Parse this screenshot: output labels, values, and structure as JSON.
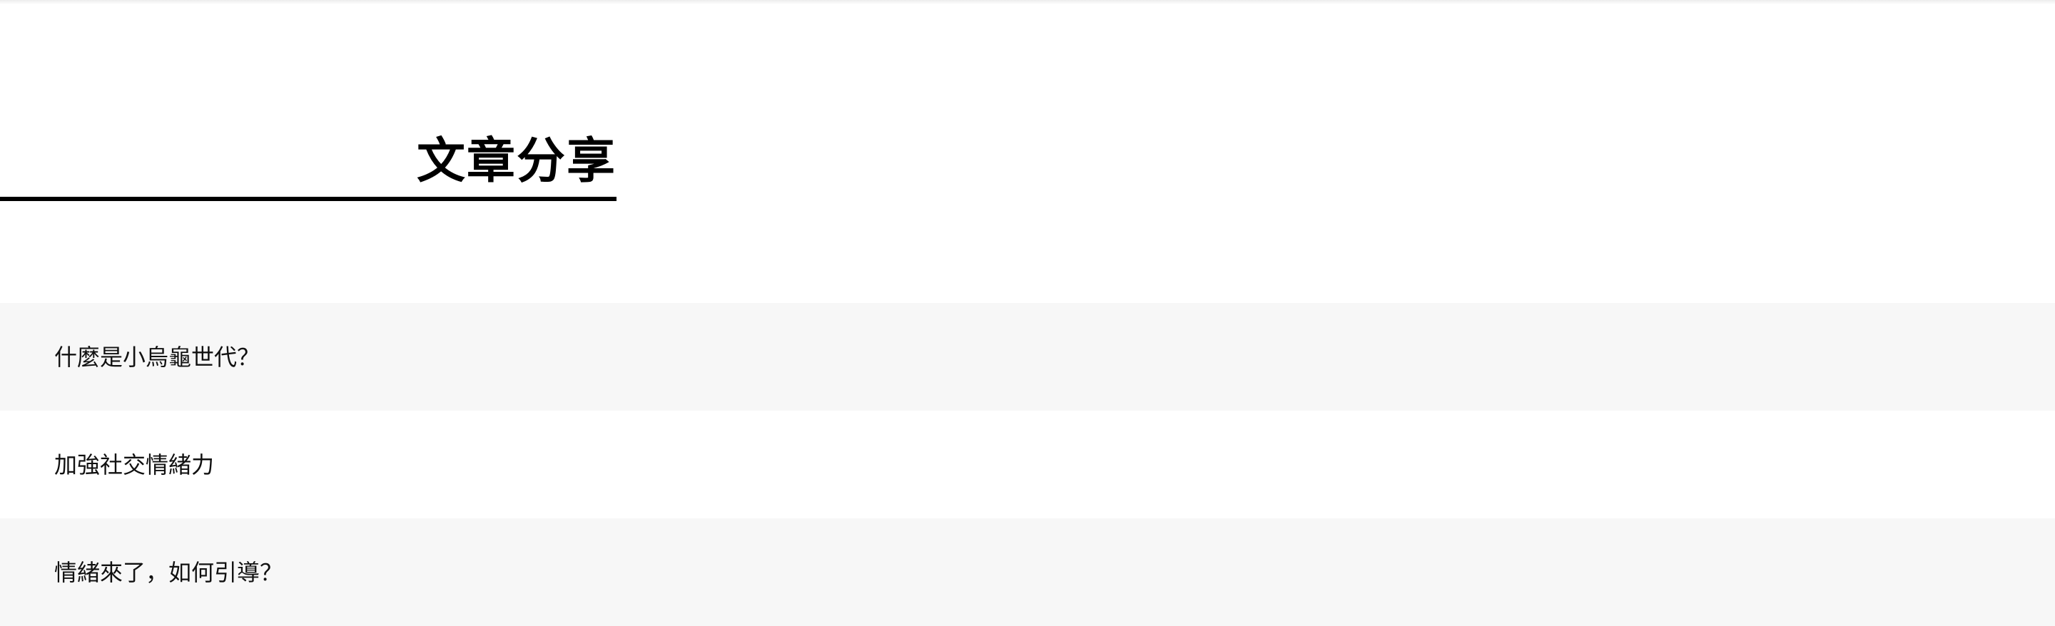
{
  "section": {
    "heading": "文章分享"
  },
  "articles": [
    {
      "title": "什麼是小烏龜世代？"
    },
    {
      "title": "加強社交情緒力"
    },
    {
      "title": "情緒來了，如何引導？"
    }
  ],
  "colors": {
    "background": "#ffffff",
    "alt_row": "#f7f7f7",
    "text": "#111111",
    "heading_rule": "#000000"
  }
}
